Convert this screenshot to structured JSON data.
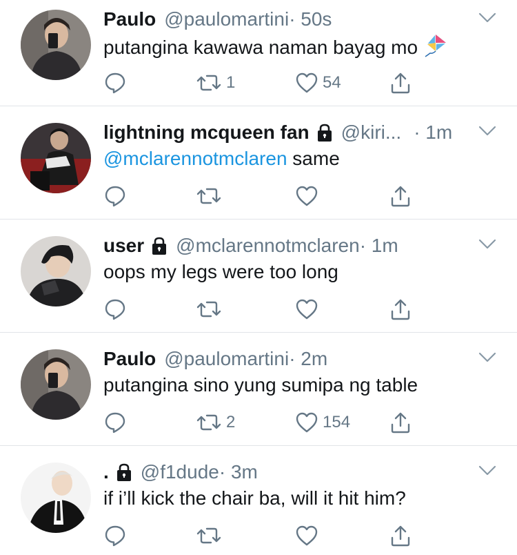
{
  "tweets": [
    {
      "name": "Paulo",
      "locked": false,
      "handle": "@paulomartini",
      "time": "· 50s",
      "text": "putangina kawawa naman bayag mo",
      "emoji": "kite-emoji",
      "retweets": "1",
      "likes": "54"
    },
    {
      "name": "lightning mcqueen fan",
      "locked": true,
      "handle": "@kiri...",
      "time": "· 1m",
      "mention": "@mclarennotmclaren",
      "text": " same",
      "retweets": "",
      "likes": ""
    },
    {
      "name": "user",
      "locked": true,
      "handle": "@mclarennotmclaren",
      "time": "· 1m",
      "text": "oops my legs were too long",
      "retweets": "",
      "likes": ""
    },
    {
      "name": "Paulo",
      "locked": false,
      "handle": "@paulomartini",
      "time": "· 2m",
      "text": "putangina sino yung sumipa ng table",
      "retweets": "2",
      "likes": "154"
    },
    {
      "name": ".",
      "locked": true,
      "handle": "@f1dude",
      "time": "· 3m",
      "text": "if i’ll kick the chair ba, will it hit him?",
      "retweets": "",
      "likes": ""
    }
  ],
  "colors": {
    "text": "#14171a",
    "secondary": "#657786",
    "mention": "#1b95e0",
    "divider": "#e1e4e8"
  },
  "icons": [
    "reply-icon",
    "retweet-icon",
    "like-icon",
    "share-icon",
    "lock-icon",
    "caret-down-icon",
    "kite-emoji"
  ]
}
